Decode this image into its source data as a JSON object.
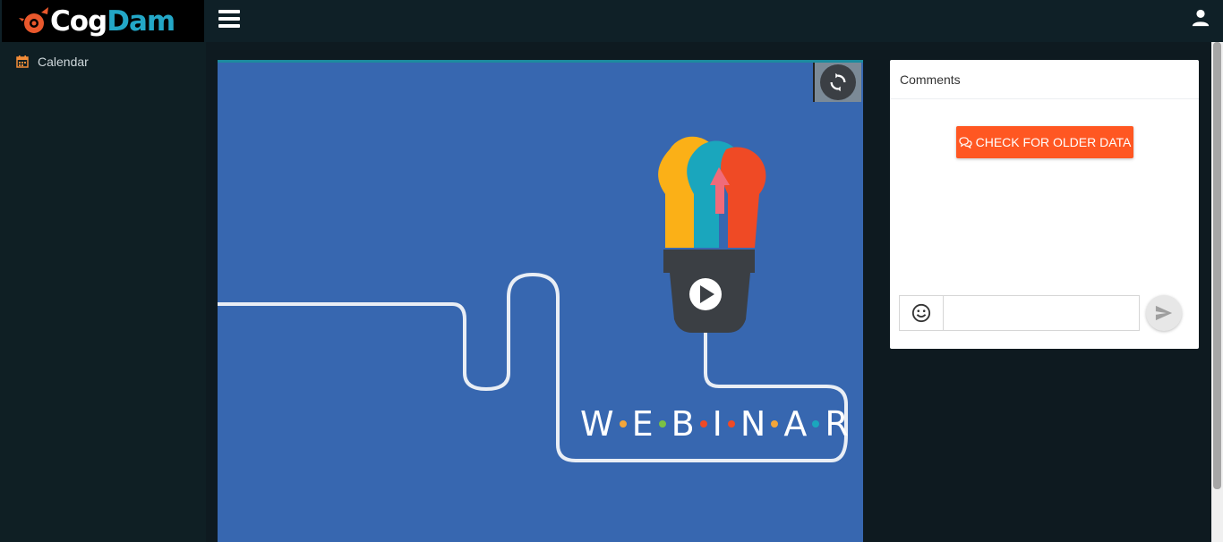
{
  "brand": {
    "logo_cog": "Cog",
    "logo_dam": "Dam"
  },
  "colors": {
    "accent": "#ff5722",
    "sidebar_bg": "#0f1f24",
    "video_bg": "#3767b0",
    "brand_teal": "#23a7c7"
  },
  "header": {
    "menu_icon": "hamburger-icon",
    "user_icon": "user-icon"
  },
  "sidebar": {
    "items": [
      {
        "label": "Calendar",
        "icon": "calendar-icon"
      }
    ]
  },
  "video": {
    "title_letters": [
      "W",
      "E",
      "B",
      "I",
      "N",
      "A",
      "R"
    ],
    "refresh_icon": "refresh-icon",
    "play_icon": "play-icon"
  },
  "comments": {
    "title": "Comments",
    "older_button_label": "CHECK FOR OLDER DATA",
    "older_button_icon": "comments-icon",
    "emoji_icon": "smiley-icon",
    "input_value": "",
    "input_placeholder": "",
    "send_icon": "send-icon"
  }
}
